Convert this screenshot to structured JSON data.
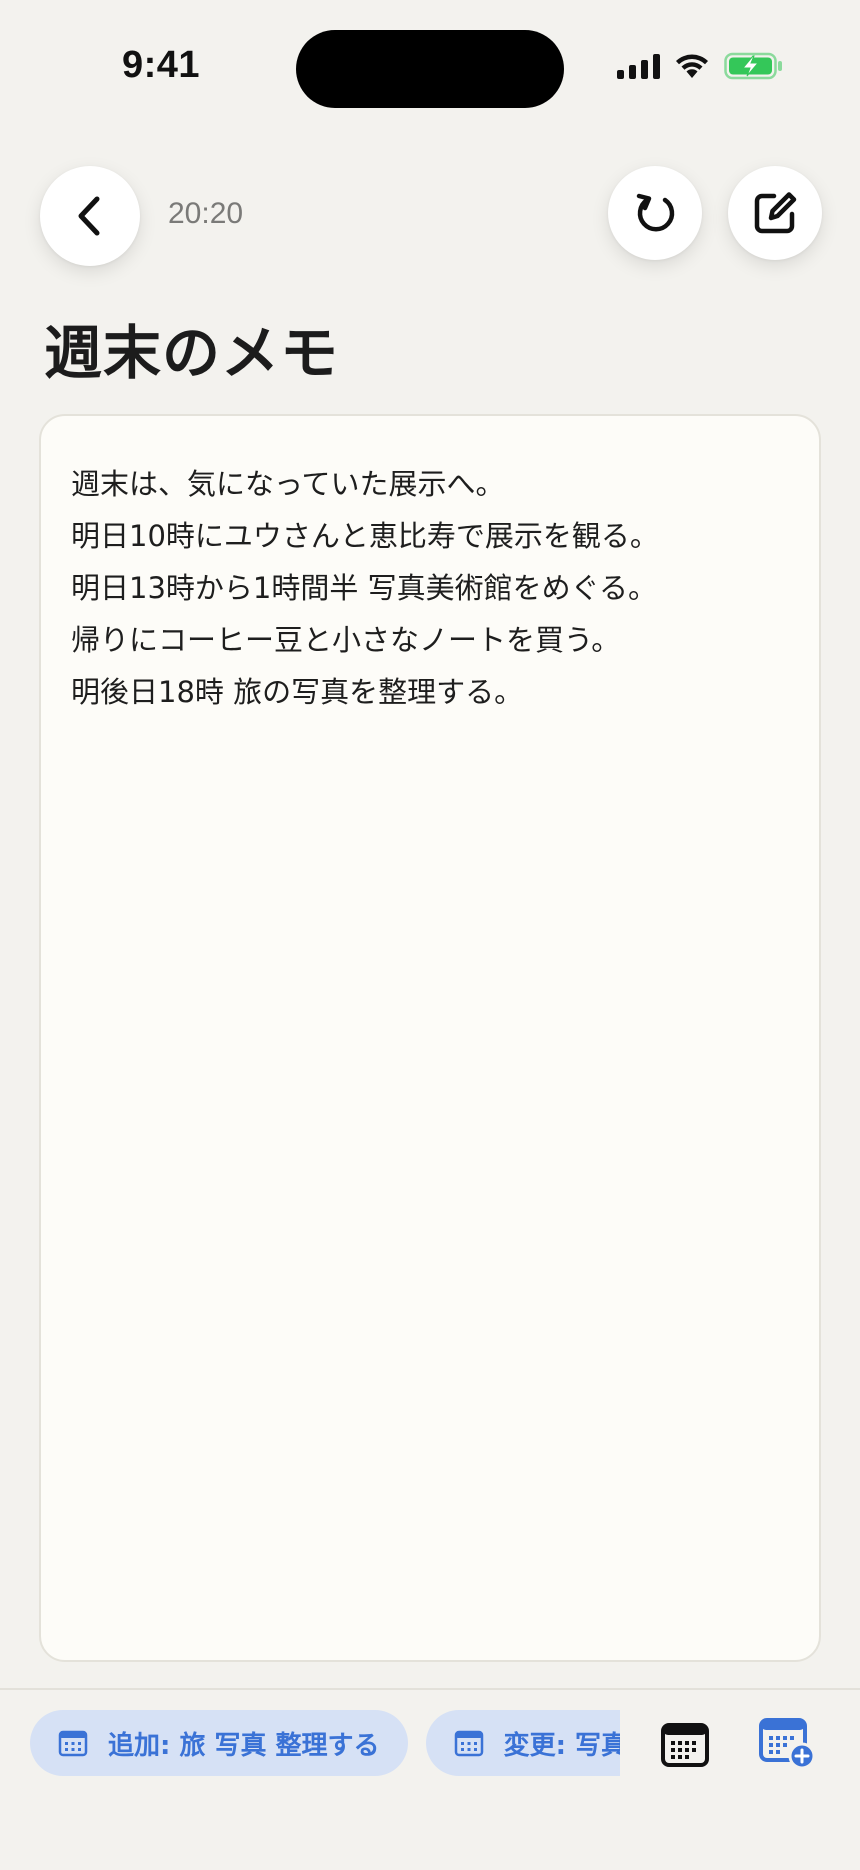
{
  "status_bar": {
    "time": "9:41"
  },
  "nav": {
    "timestamp": "20:20"
  },
  "note": {
    "title": "週末のメモ",
    "lines": [
      "週末は、気になっていた展示へ。",
      "明日10時にユウさんと恵比寿で展示を観る。",
      "明日13時から1時間半 写真美術館をめぐる。",
      "帰りにコーヒー豆と小さなノートを買う。",
      "明後日18時 旅の写真を整理する。"
    ]
  },
  "actions": {
    "chips": [
      {
        "label": "追加: 旅 写真 整理する"
      },
      {
        "label": "変更: 写真美術館をめぐる"
      }
    ]
  },
  "colors": {
    "background": "#f3f2ee",
    "card": "#fdfcf8",
    "chip_bg": "#d6e1f5",
    "accent": "#3a72d6",
    "battery_green": "#34c759"
  },
  "icons": {
    "back": "chevron-left-icon",
    "undo": "undo-icon",
    "edit": "compose-icon",
    "chip": "calendar-icon",
    "calendar": "calendar-icon",
    "calendar_add": "calendar-add-icon"
  }
}
